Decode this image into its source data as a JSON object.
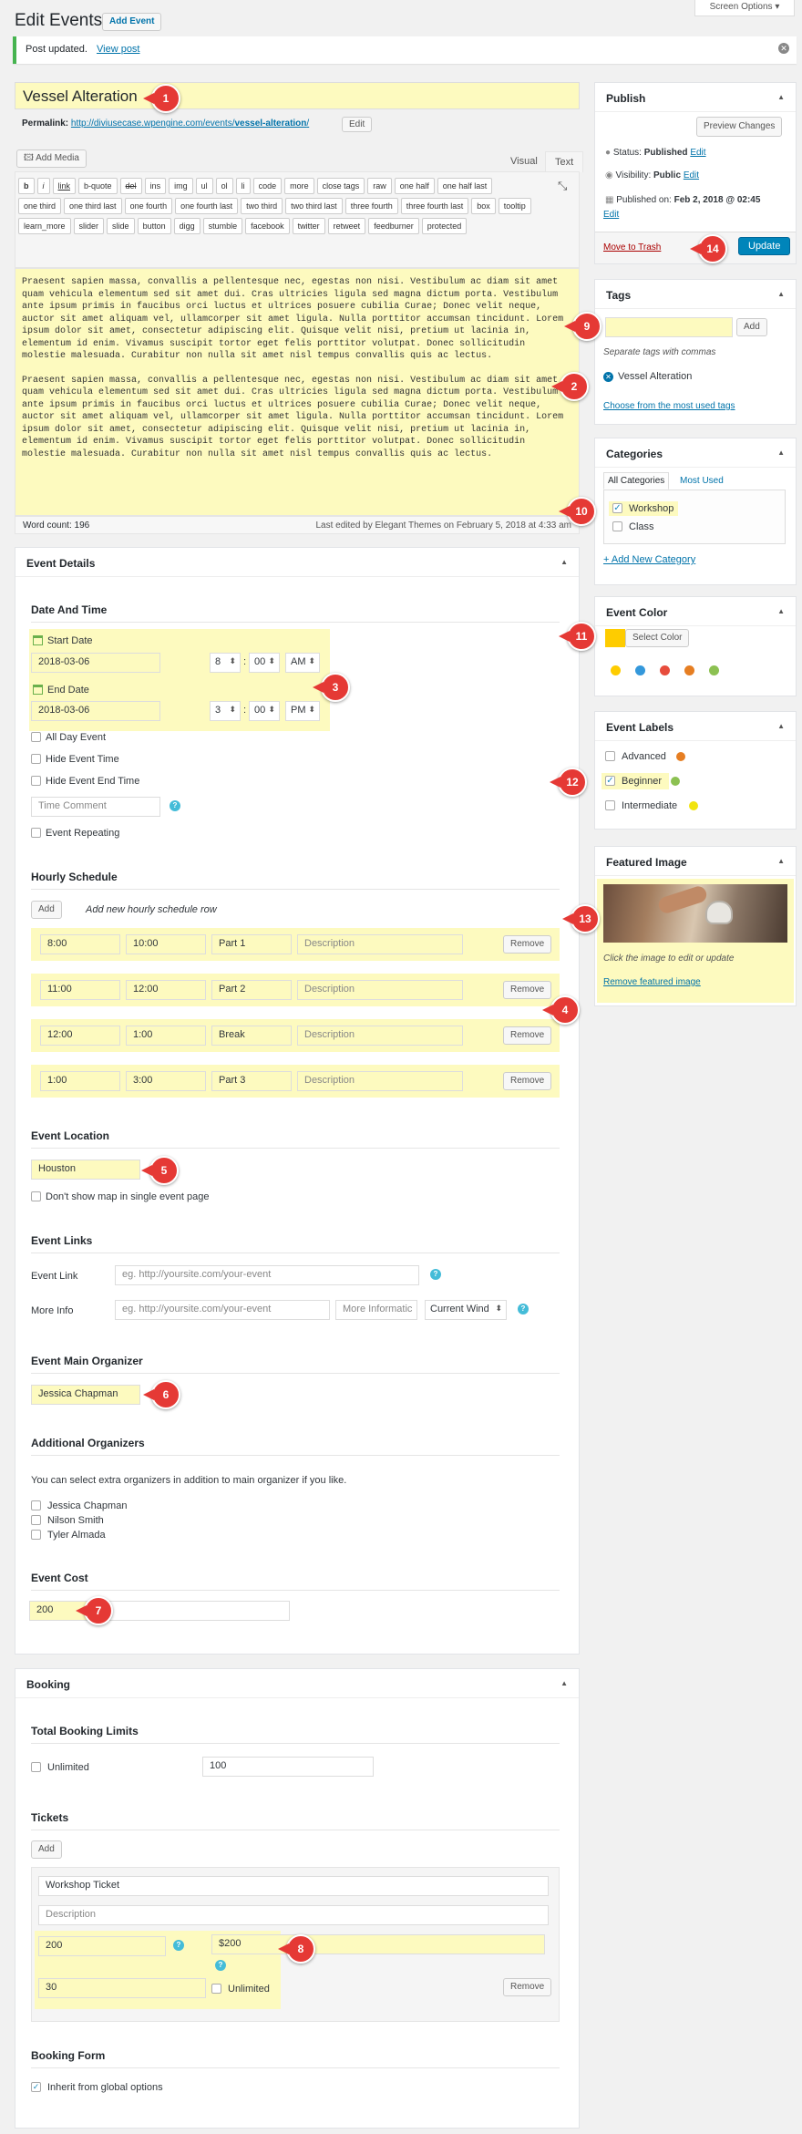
{
  "header": {
    "title": "Edit Events",
    "add_new": "Add Event",
    "screen_options": "Screen Options ▾"
  },
  "notice": {
    "text": "Post updated.",
    "link": "View post"
  },
  "post": {
    "title": "Vessel Alteration",
    "permalink_label": "Permalink:",
    "permalink_base": "http://diviusecase.wpengine.com/events/",
    "permalink_slug": "vessel-alteration",
    "permalink_end": "/",
    "edit": "Edit"
  },
  "editor": {
    "add_media": "Add Media",
    "tab_visual": "Visual",
    "tab_text": "Text",
    "quicktags": [
      "b",
      "i",
      "link",
      "b-quote",
      "del",
      "ins",
      "img",
      "ul",
      "ol",
      "li",
      "code",
      "more",
      "close tags",
      "raw",
      "one half",
      "one half last",
      "one third",
      "one third last",
      "one fourth",
      "one fourth last",
      "two third",
      "two third last",
      "three fourth",
      "three fourth last",
      "box",
      "tooltip",
      "learn_more",
      "slider",
      "slide",
      "button",
      "digg",
      "stumble",
      "facebook",
      "twitter",
      "retweet",
      "feedburner",
      "protected"
    ],
    "paragraph1": "Praesent sapien massa, convallis a pellentesque nec, egestas non nisi. Vestibulum ac diam sit amet quam vehicula elementum sed sit amet dui. Cras ultricies ligula sed magna dictum porta. Vestibulum ante ipsum primis in faucibus orci luctus et ultrices posuere cubilia Curae; Donec velit neque, auctor sit amet aliquam vel, ullamcorper sit amet ligula. Nulla porttitor accumsan tincidunt. Lorem ipsum dolor sit amet, consectetur adipiscing elit. Quisque velit nisi, pretium ut lacinia in, elementum id enim. Vivamus suscipit tortor eget felis porttitor volutpat. Donec sollicitudin molestie malesuada. Curabitur non nulla sit amet nisl tempus convallis quis ac lectus.",
    "paragraph2": "Praesent sapien massa, convallis a pellentesque nec, egestas non nisi. Vestibulum ac diam sit amet quam vehicula elementum sed sit amet dui. Cras ultricies ligula sed magna dictum porta. Vestibulum ante ipsum primis in faucibus orci luctus et ultrices posuere cubilia Curae; Donec velit neque, auctor sit amet aliquam vel, ullamcorper sit amet ligula. Nulla porttitor accumsan tincidunt. Lorem ipsum dolor sit amet, consectetur adipiscing elit. Quisque velit nisi, pretium ut lacinia in, elementum id enim. Vivamus suscipit tortor eget felis porttitor volutpat. Donec sollicitudin molestie malesuada. Curabitur non nulla sit amet nisl tempus convallis quis ac lectus.",
    "word_count": "Word count: 196",
    "last_edited": "Last edited by Elegant Themes on February 5, 2018 at 4:33 am"
  },
  "event_details": {
    "title": "Event Details",
    "date_heading": "Date And Time",
    "start_label": "Start Date",
    "start_date": "2018-03-06",
    "start_hour": "8",
    "start_min": "00",
    "start_ampm": "AM",
    "end_label": "End Date",
    "end_date": "2018-03-06",
    "end_hour": "3",
    "end_min": "00",
    "end_ampm": "PM",
    "colon": ":",
    "all_day": "All Day Event",
    "hide_time": "Hide Event Time",
    "hide_end": "Hide Event End Time",
    "time_comment": "Time Comment",
    "repeating": "Event Repeating",
    "hourly_heading": "Hourly Schedule",
    "add": "Add",
    "add_hint": "Add new hourly schedule row",
    "schedule": [
      {
        "from": "8:00",
        "to": "10:00",
        "title": "Part 1",
        "desc": "Description"
      },
      {
        "from": "11:00",
        "to": "12:00",
        "title": "Part 2",
        "desc": "Description"
      },
      {
        "from": "12:00",
        "to": "1:00",
        "title": "Break",
        "desc": "Description"
      },
      {
        "from": "1:00",
        "to": "3:00",
        "title": "Part 3",
        "desc": "Description"
      }
    ],
    "remove": "Remove",
    "location_heading": "Event Location",
    "location": "Houston",
    "no_map": "Don't show map in single event page",
    "links_heading": "Event Links",
    "event_link_label": "Event Link",
    "event_link_ph": "eg. http://yoursite.com/your-event",
    "more_info_label": "More Info",
    "more_info_ph": "eg. http://yoursite.com/your-event",
    "more_info_text": "More Informatic",
    "window": "Current Wind",
    "organizer_heading": "Event Main Organizer",
    "organizer": "Jessica Chapman",
    "additional_heading": "Additional Organizers",
    "additional_hint": "You can select extra organizers in addition to main organizer if you like.",
    "organizers": [
      "Jessica Chapman",
      "Nilson Smith",
      "Tyler Almada"
    ],
    "cost_heading": "Event Cost",
    "cost": "200"
  },
  "booking": {
    "title": "Booking",
    "limits_heading": "Total Booking Limits",
    "unlimited": "Unlimited",
    "limit_value": "100",
    "tickets_heading": "Tickets",
    "add": "Add",
    "ticket_name": "Workshop Ticket",
    "ticket_desc": "Description",
    "ticket_qty": "200",
    "ticket_price": "$200",
    "ticket_limit": "30",
    "ticket_unlimited": "Unlimited",
    "remove": "Remove",
    "form_heading": "Booking Form",
    "inherit": "Inherit from global options"
  },
  "publish": {
    "title": "Publish",
    "preview": "Preview Changes",
    "status_label": "Status:",
    "status": "Published",
    "edit": "Edit",
    "visibility_label": "Visibility:",
    "visibility": "Public",
    "published_label": "Published on:",
    "published": "Feb 2, 2018 @ 02:45",
    "trash": "Move to Trash",
    "update": "Update"
  },
  "tags": {
    "title": "Tags",
    "add": "Add",
    "hint": "Separate tags with commas",
    "current": "Vessel Alteration",
    "choose": "Choose from the most used tags"
  },
  "categories": {
    "title": "Categories",
    "tab_all": "All Categories",
    "tab_used": "Most Used",
    "items": [
      "Workshop",
      "Class"
    ],
    "add_new": "+ Add New Category"
  },
  "event_color": {
    "title": "Event Color",
    "select": "Select Color",
    "current": "#fecc00",
    "swatches": [
      "#fecc00",
      "#3498db",
      "#e74c3c",
      "#e67e22",
      "#8cc152"
    ]
  },
  "event_labels": {
    "title": "Event Labels",
    "items": [
      {
        "name": "Advanced",
        "color": "#e67e22"
      },
      {
        "name": "Beginner",
        "color": "#8cc152"
      },
      {
        "name": "Intermediate",
        "color": "#f1e40f"
      }
    ]
  },
  "featured": {
    "title": "Featured Image",
    "hint": "Click the image to edit or update",
    "remove": "Remove featured image"
  },
  "markers": [
    "1",
    "2",
    "3",
    "4",
    "5",
    "6",
    "7",
    "8",
    "9",
    "10",
    "11",
    "12",
    "13",
    "14"
  ]
}
